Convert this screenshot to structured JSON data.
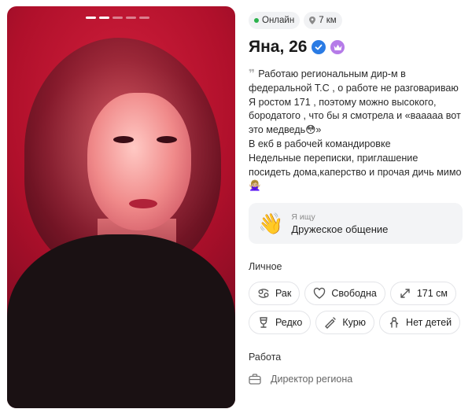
{
  "photo": {
    "slide_count": 5,
    "active_index": 0
  },
  "status": {
    "online": "Онлайн",
    "distance": "7 км"
  },
  "profile": {
    "name_age": "Яна, 26"
  },
  "bio": {
    "quote_mark": "❞",
    "lines": [
      "Работаю региональным дир-м в федеральной Т.С , о работе не разговариваю",
      "Я ростом 171 , поэтому можно высокого, бородатого , что бы я смотрела и «вааааа вот это медведь😳»",
      "В екб в рабочей командировке",
      "Недельные переписки, приглашение посидеть дома,каперство и прочая дичь мимо🙅🏼‍♀️"
    ]
  },
  "looking_for": {
    "emoji": "👋",
    "label": "Я ищу",
    "value": "Дружеское общение"
  },
  "personal": {
    "title": "Личное",
    "zodiac": "Рак",
    "relationship": "Свободна",
    "height": "171 см",
    "drinking": "Редко",
    "smoking": "Курю",
    "children": "Нет детей"
  },
  "work": {
    "title": "Работа",
    "position": "Директор региона"
  },
  "colors": {
    "online": "#2bb24c",
    "verified": "#2a7be4",
    "premium": "#b57be8"
  }
}
